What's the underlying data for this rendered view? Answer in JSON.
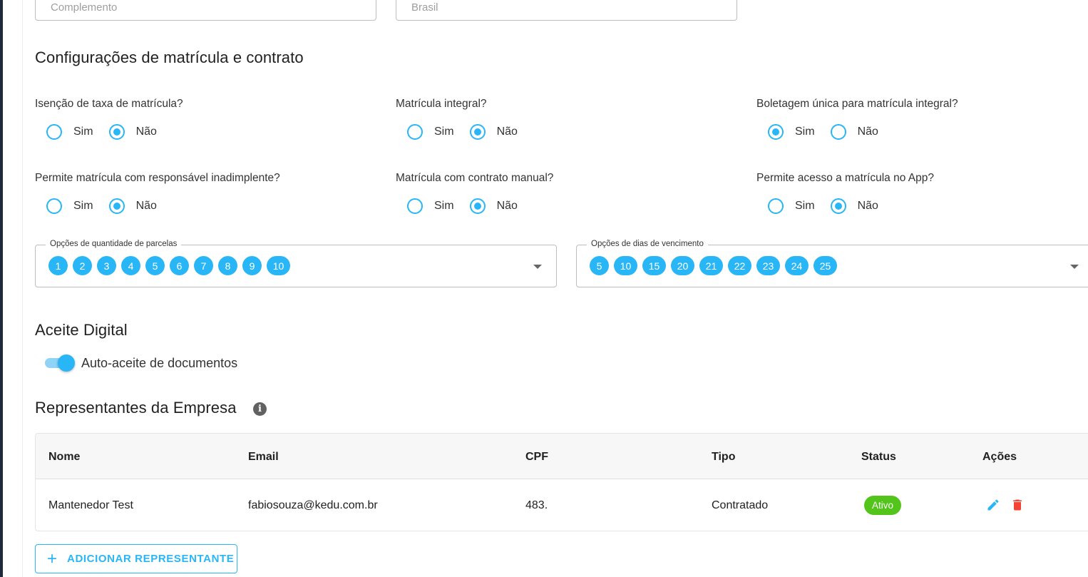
{
  "address": {
    "complemento_placeholder": "Complemento",
    "pais_value": "Brasil"
  },
  "config_section": {
    "title": "Configurações de matrícula e contrato",
    "questions": [
      {
        "label": "Isenção de taxa de matrícula?",
        "yes": "Sim",
        "no": "Não",
        "selected": "no"
      },
      {
        "label": "Matrícula integral?",
        "yes": "Sim",
        "no": "Não",
        "selected": "no"
      },
      {
        "label": "Boletagem única para matrícula integral?",
        "yes": "Sim",
        "no": "Não",
        "selected": "yes"
      },
      {
        "label": "Permite matrícula com responsável inadimplente?",
        "yes": "Sim",
        "no": "Não",
        "selected": "no"
      },
      {
        "label": "Matrícula com contrato manual?",
        "yes": "Sim",
        "no": "Não",
        "selected": "no"
      },
      {
        "label": "Permite acesso a matrícula no App?",
        "yes": "Sim",
        "no": "Não",
        "selected": "no"
      }
    ],
    "parcelas": {
      "legend": "Opções de quantidade de parcelas",
      "chips": [
        "1",
        "2",
        "3",
        "4",
        "5",
        "6",
        "7",
        "8",
        "9",
        "10"
      ]
    },
    "vencimento": {
      "legend": "Opções de dias de vencimento",
      "chips": [
        "5",
        "10",
        "15",
        "20",
        "21",
        "22",
        "23",
        "24",
        "25"
      ]
    }
  },
  "aceite": {
    "title": "Aceite Digital",
    "toggle_label": "Auto-aceite de documentos",
    "toggle_on": true
  },
  "representantes": {
    "title": "Representantes da Empresa",
    "info_glyph": "i",
    "columns": {
      "nome": "Nome",
      "email": "Email",
      "cpf": "CPF",
      "tipo": "Tipo",
      "status": "Status",
      "acoes": "Ações"
    },
    "rows": [
      {
        "nome": "Mantenedor Test",
        "email": "fabiosouza@kedu.com.br",
        "cpf": "483.",
        "tipo": "Contratado",
        "status": "Ativo"
      }
    ],
    "add_button": "ADICIONAR REPRESENTANTE",
    "add_icon": "+"
  },
  "colors": {
    "accent": "#29b6f6",
    "status_active": "#52c41a",
    "delete": "#f44336"
  }
}
